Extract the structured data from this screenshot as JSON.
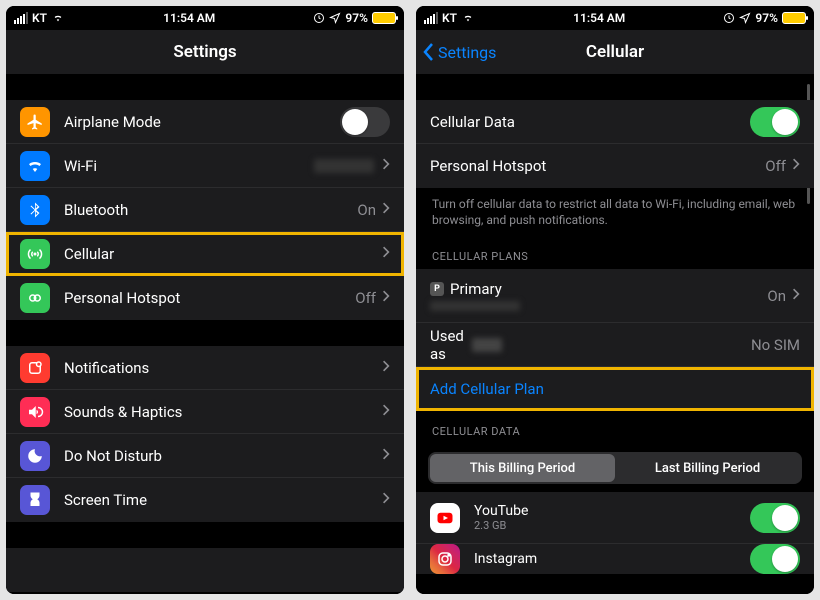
{
  "status": {
    "carrier": "KT",
    "time": "11:54 AM",
    "battery": "97%"
  },
  "left": {
    "title": "Settings",
    "rows": {
      "airplane": "Airplane Mode",
      "wifi": "Wi-Fi",
      "bluetooth": "Bluetooth",
      "bluetooth_val": "On",
      "cellular": "Cellular",
      "hotspot": "Personal Hotspot",
      "hotspot_val": "Off",
      "notifications": "Notifications",
      "sounds": "Sounds & Haptics",
      "dnd": "Do Not Disturb",
      "screentime": "Screen Time"
    }
  },
  "right": {
    "back": "Settings",
    "title": "Cellular",
    "rows": {
      "cell_data": "Cellular Data",
      "hotspot": "Personal Hotspot",
      "hotspot_val": "Off"
    },
    "note": "Turn off cellular data to restrict all data to Wi-Fi, including email, web browsing, and push notifications.",
    "plans_header": "CELLULAR PLANS",
    "primary_badge": "P",
    "primary": "Primary",
    "primary_val": "On",
    "used_as": "Used as",
    "used_as_val": "No SIM",
    "add_plan": "Add Cellular Plan",
    "data_header": "CELLULAR DATA",
    "seg_this": "This Billing Period",
    "seg_last": "Last Billing Period",
    "apps": {
      "youtube": {
        "name": "YouTube",
        "usage": "2.3 GB"
      },
      "instagram": {
        "name": "Instagram"
      }
    }
  }
}
